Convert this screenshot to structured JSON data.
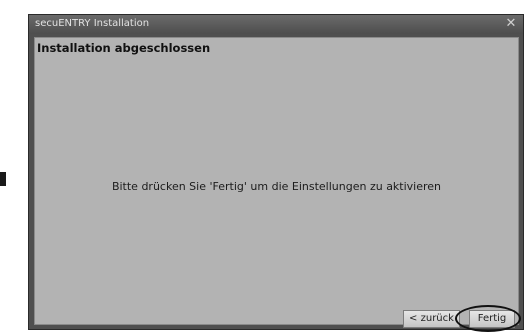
{
  "window": {
    "title": "secuENTRY Installation",
    "close_symbol": "✕"
  },
  "page": {
    "heading": "Installation abgeschlossen",
    "message": "Bitte drücken Sie 'Fertig' um die Einstellungen zu aktivieren"
  },
  "buttons": {
    "back_label": "< zurück",
    "finish_label": "Fertig"
  },
  "icons": {
    "close": "close-icon"
  },
  "colors": {
    "window_frame": "#4f4f4f",
    "client_background": "#b3b3b3",
    "annotation_oval": "#111111"
  }
}
